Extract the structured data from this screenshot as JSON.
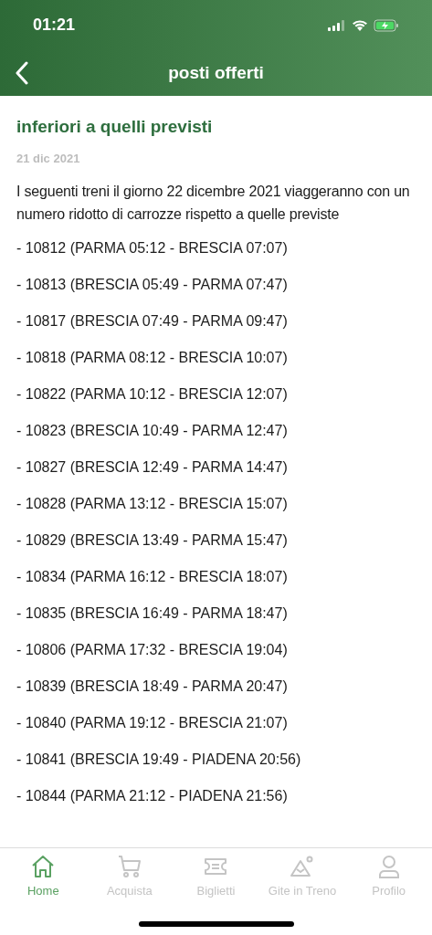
{
  "status_bar": {
    "time": "01:21"
  },
  "nav": {
    "title": "posti offerti"
  },
  "article": {
    "title": "inferiori a quelli previsti",
    "date": "21 dic 2021",
    "intro": "I seguenti treni il giorno 22 dicembre 2021 viaggeranno con un numero ridotto di carrozze rispetto a quelle previste",
    "trains": [
      "- 10812 (PARMA 05:12 - BRESCIA 07:07)",
      "- 10813 (BRESCIA 05:49 - PARMA 07:47)",
      "- 10817 (BRESCIA 07:49 - PARMA 09:47)",
      "- 10818 (PARMA 08:12 - BRESCIA 10:07)",
      "- 10822 (PARMA 10:12 - BRESCIA 12:07)",
      "- 10823 (BRESCIA 10:49 - PARMA 12:47)",
      "- 10827 (BRESCIA 12:49 - PARMA 14:47)",
      "- 10828 (PARMA 13:12 - BRESCIA 15:07)",
      "- 10829 (BRESCIA 13:49 - PARMA 15:47)",
      "- 10834 (PARMA 16:12 - BRESCIA 18:07)",
      "- 10835 (BRESCIA 16:49 - PARMA 18:47)",
      "- 10806 (PARMA 17:32 - BRESCIA 19:04)",
      "- 10839 (BRESCIA 18:49 - PARMA 20:47)",
      "- 10840 (PARMA 19:12 - BRESCIA 21:07)",
      "- 10841 (BRESCIA 19:49 - PIADENA 20:56)",
      "- 10844 (PARMA 21:12 - PIADENA 21:56)"
    ]
  },
  "tab_bar": [
    {
      "label": "Home",
      "selected": true
    },
    {
      "label": "Acquista",
      "selected": false
    },
    {
      "label": "Biglietti",
      "selected": false
    },
    {
      "label": "Gite in Treno",
      "selected": false
    },
    {
      "label": "Profilo",
      "selected": false
    }
  ]
}
